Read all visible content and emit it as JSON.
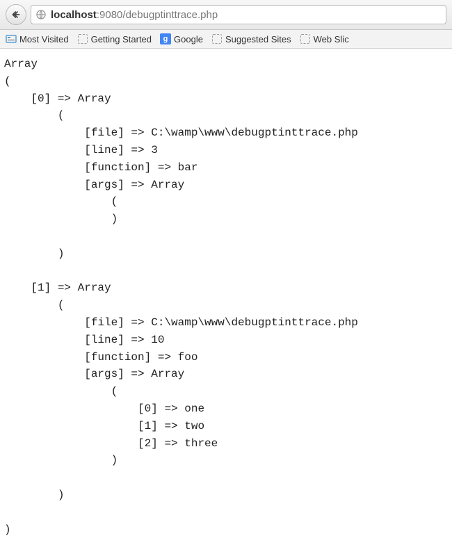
{
  "url": {
    "host": "localhost",
    "port": ":9080",
    "path": "/debugptinttrace.php"
  },
  "bookmarks": {
    "most_visited": "Most Visited",
    "getting_started": "Getting Started",
    "google": "Google",
    "google_glyph": "g",
    "suggested_sites": "Suggested Sites",
    "web_slice": "Web Slic"
  },
  "output": {
    "root_type": "Array",
    "brace_open": "(",
    "brace_close": ")",
    "arrow": "=>",
    "items": [
      {
        "key_label": "[0]",
        "type": "Array",
        "fields": {
          "file_key": "[file]",
          "file_val": "C:\\wamp\\www\\debugptinttrace.php",
          "line_key": "[line]",
          "line_val": "3",
          "func_key": "[function]",
          "func_val": "bar",
          "args_key": "[args]",
          "args_type": "Array"
        },
        "args": []
      },
      {
        "key_label": "[1]",
        "type": "Array",
        "fields": {
          "file_key": "[file]",
          "file_val": "C:\\wamp\\www\\debugptinttrace.php",
          "line_key": "[line]",
          "line_val": "10",
          "func_key": "[function]",
          "func_val": "foo",
          "args_key": "[args]",
          "args_type": "Array"
        },
        "args": [
          {
            "key": "[0]",
            "val": "one"
          },
          {
            "key": "[1]",
            "val": "two"
          },
          {
            "key": "[2]",
            "val": "three"
          }
        ]
      }
    ]
  }
}
